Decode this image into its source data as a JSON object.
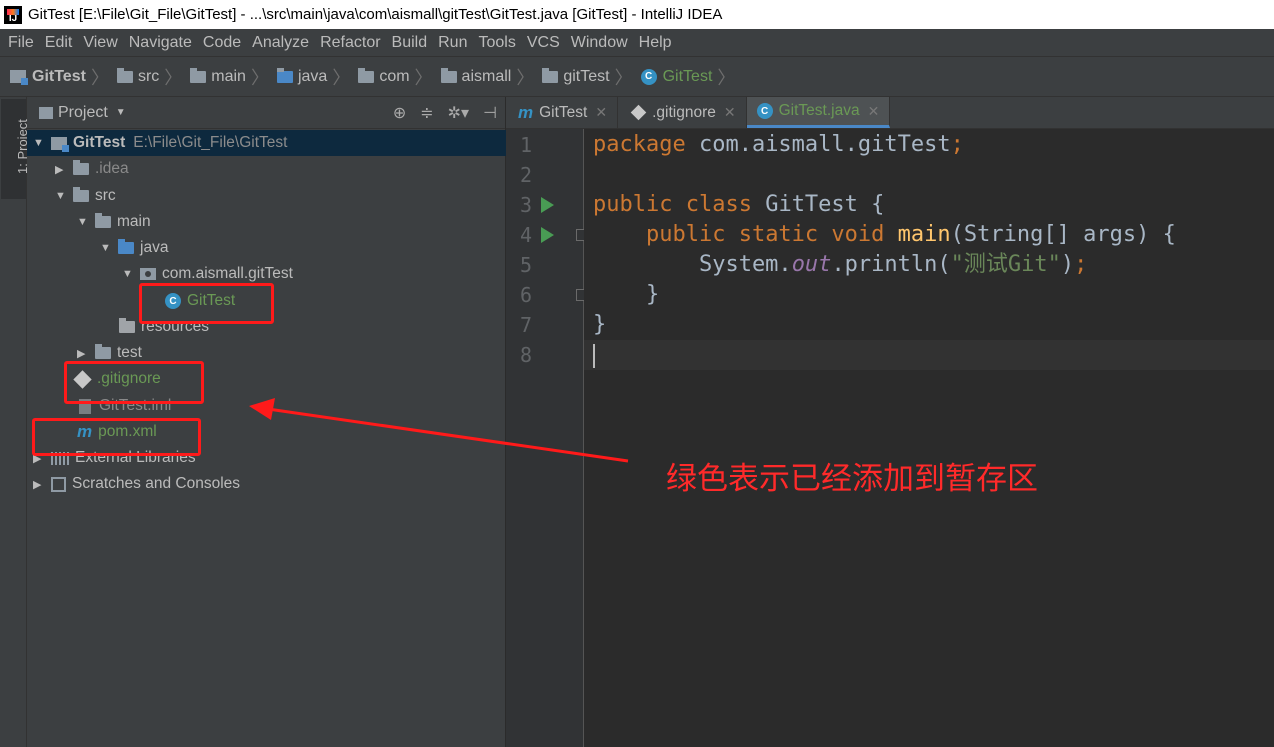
{
  "window": {
    "title": "GitTest [E:\\File\\Git_File\\GitTest] - ...\\src\\main\\java\\com\\aismall\\gitTest\\GitTest.java [GitTest] - IntelliJ IDEA"
  },
  "menu": [
    "File",
    "Edit",
    "View",
    "Navigate",
    "Code",
    "Analyze",
    "Refactor",
    "Build",
    "Run",
    "Tools",
    "VCS",
    "Window",
    "Help"
  ],
  "breadcrumb": [
    "GitTest",
    "src",
    "main",
    "java",
    "com",
    "aismall",
    "gitTest",
    "GitTest"
  ],
  "stripe": {
    "project_tab": "1: Project"
  },
  "project_panel": {
    "title": "Project",
    "tree": [
      {
        "label": "GitTest",
        "path": "E:\\File\\Git_File\\GitTest",
        "icon": "module-icon",
        "expanded": true
      },
      {
        "label": ".idea",
        "icon": "folder-icon",
        "expanded": false
      },
      {
        "label": "src",
        "icon": "folder-icon",
        "expanded": true
      },
      {
        "label": "main",
        "icon": "folder-icon",
        "expanded": true
      },
      {
        "label": "java",
        "icon": "source-folder-icon",
        "expanded": true
      },
      {
        "label": "com.aismall.gitTest",
        "icon": "package-icon",
        "expanded": true
      },
      {
        "label": "GitTest",
        "icon": "class-icon",
        "status": "added"
      },
      {
        "label": "resources",
        "icon": "resources-folder-icon"
      },
      {
        "label": "test",
        "icon": "folder-icon",
        "expanded": false
      },
      {
        "label": ".gitignore",
        "icon": "git-icon",
        "status": "added"
      },
      {
        "label": "GitTest.iml",
        "icon": "iml-file-icon",
        "status": "ignored"
      },
      {
        "label": "pom.xml",
        "icon": "maven-icon",
        "status": "added"
      },
      {
        "label": "External Libraries",
        "icon": "library-icon",
        "expanded": false
      },
      {
        "label": "Scratches and Consoles",
        "icon": "scratches-icon",
        "expanded": false
      }
    ]
  },
  "editor": {
    "tabs": [
      {
        "label": "GitTest",
        "icon": "maven-icon"
      },
      {
        "label": ".gitignore",
        "icon": "git-icon"
      },
      {
        "label": "GitTest.java",
        "icon": "class-icon",
        "active": true
      }
    ],
    "line_numbers": [
      "1",
      "2",
      "3",
      "4",
      "5",
      "6",
      "7",
      "8"
    ],
    "code": {
      "l1_kw": "package",
      "l1_rest": " com.aismall.gitTest",
      "l1_semi": ";",
      "l3_kw": "public class",
      "l3_rest": " GitTest {",
      "l4_indent": "    ",
      "l4_kw": "public static void",
      "l4_fn": "main",
      "l4_rest": "(String[] args) {",
      "l5_a": "        System.",
      "l5_static": "out",
      "l5_b": ".println(",
      "l5_str": "\"测试Git\"",
      "l5_c": ")",
      "l5_semi": ";",
      "l6": "    }",
      "l7": "}"
    }
  },
  "annotation": {
    "text": "绿色表示已经添加到暂存区",
    "color": "#ff2a2a"
  },
  "colors": {
    "added_file": "#6a9955",
    "keyword": "#cc7832",
    "function": "#ffc66d",
    "string": "#6a8759",
    "highlight_box": "#ff1a1a"
  }
}
